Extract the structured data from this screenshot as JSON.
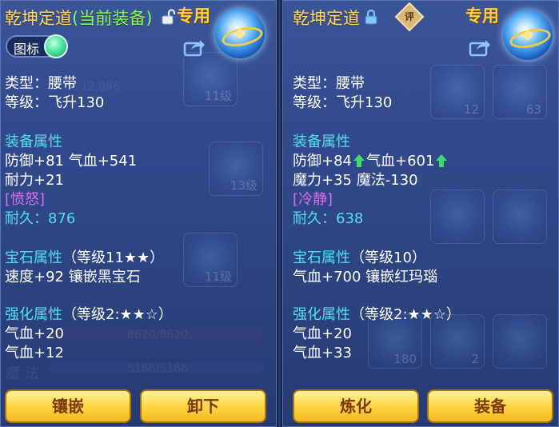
{
  "left": {
    "title": "乾坤定道",
    "current_tag": "(当前装备)",
    "special_badge": "专用",
    "toggle_label": "图标",
    "type": "类型：腰带",
    "level": "等级：飞升130",
    "equip_header": "装备属性",
    "attr_line1": "防御+81 气血+541",
    "attr_line2": "耐力+21",
    "special_effect": "[愤怒]",
    "durability": "耐久：876",
    "gem_header": "宝石属性",
    "gem_level": "（等级11★★）",
    "gem_line": "速度+92 镶嵌黑宝石",
    "enhance_header": "强化属性",
    "enhance_level": "（等级2:★★☆）",
    "enhance_line1": "气血+20",
    "enhance_line2": "气血+12",
    "button_1": "镶嵌",
    "button_2": "卸下",
    "bg_texts": [
      "11级",
      "13级",
      "11级",
      "8620/8620",
      "5166/5166",
      "魔 法",
      "12,896"
    ]
  },
  "right": {
    "title": "乾坤定道",
    "review_badge": "评",
    "special_badge": "专用",
    "type": "类型：腰带",
    "level": "等级：飞升130",
    "equip_header": "装备属性",
    "attr_def": "防御+84",
    "attr_hp": "气血+601",
    "attr_line2": "魔力+35 魔法-130",
    "special_effect": "[冷静]",
    "durability": "耐久：638",
    "gem_header": "宝石属性",
    "gem_level": "（等级10）",
    "gem_line": "气血+700 镶嵌红玛瑙",
    "enhance_header": "强化属性",
    "enhance_level": "（等级2:★★☆）",
    "enhance_line1": "气血+20",
    "enhance_line2": "气血+33",
    "button_1": "炼化",
    "button_2": "装备",
    "bg_texts": [
      "12",
      "63",
      "180",
      "2"
    ]
  },
  "colors": {
    "title": "#ffd86a",
    "current_tag": "#7cff6a",
    "header": "#4fe0f0",
    "effect": "#e06cf0",
    "button_text": "#7a3a06"
  }
}
